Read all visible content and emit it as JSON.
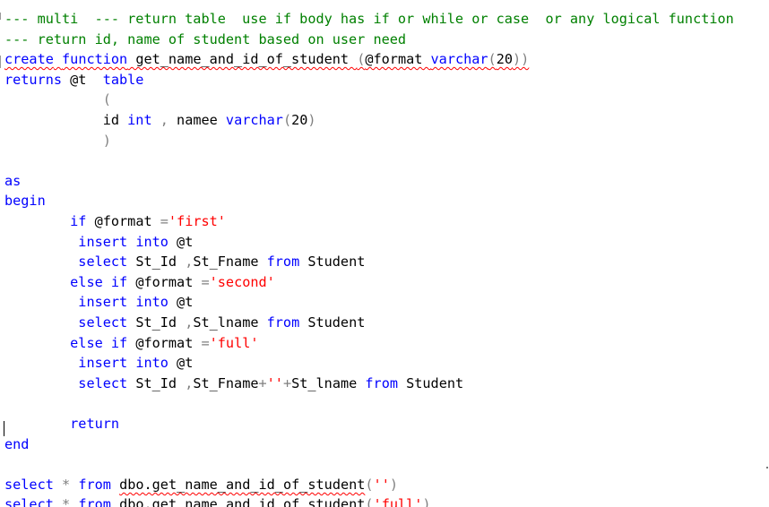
{
  "editor": {
    "lines": [
      {
        "tokens": [
          {
            "t": "--- multi  --- return table  use if body has if or while or case  or any logical function",
            "c": "cm"
          }
        ]
      },
      {
        "tokens": [
          {
            "t": "--- return id, name of student based on user need",
            "c": "cm"
          }
        ]
      },
      {
        "tokens": [
          {
            "t": "create",
            "c": "kw",
            "w": 1
          },
          {
            "t": " ",
            "c": "tx",
            "w": 1
          },
          {
            "t": "function",
            "c": "kw",
            "w": 1
          },
          {
            "t": " get_name_and_id_of_student ",
            "c": "tx",
            "w": 1
          },
          {
            "t": "(",
            "c": "op",
            "w": 1
          },
          {
            "t": "@format ",
            "c": "tx",
            "w": 1
          },
          {
            "t": "varchar",
            "c": "kw",
            "w": 1
          },
          {
            "t": "(",
            "c": "op",
            "w": 1
          },
          {
            "t": "20",
            "c": "tx",
            "w": 1
          },
          {
            "t": "))",
            "c": "op",
            "w": 1
          }
        ]
      },
      {
        "tokens": [
          {
            "t": "returns",
            "c": "kw"
          },
          {
            "t": " @t  ",
            "c": "tx"
          },
          {
            "t": "table",
            "c": "kw"
          }
        ]
      },
      {
        "tokens": [
          {
            "t": "            ",
            "c": "tx"
          },
          {
            "t": "(",
            "c": "op"
          }
        ]
      },
      {
        "tokens": [
          {
            "t": "            id ",
            "c": "tx"
          },
          {
            "t": "int",
            "c": "kw"
          },
          {
            "t": " ",
            "c": "tx"
          },
          {
            "t": ",",
            "c": "op"
          },
          {
            "t": " namee ",
            "c": "tx"
          },
          {
            "t": "varchar",
            "c": "kw"
          },
          {
            "t": "(",
            "c": "op"
          },
          {
            "t": "20",
            "c": "tx"
          },
          {
            "t": ")",
            "c": "op"
          }
        ]
      },
      {
        "tokens": [
          {
            "t": "            ",
            "c": "tx"
          },
          {
            "t": ")",
            "c": "op"
          }
        ]
      },
      {
        "tokens": []
      },
      {
        "tokens": [
          {
            "t": "as",
            "c": "kw"
          }
        ]
      },
      {
        "tokens": [
          {
            "t": "begin",
            "c": "kw"
          }
        ]
      },
      {
        "tokens": [
          {
            "t": "        ",
            "c": "tx"
          },
          {
            "t": "if",
            "c": "kw"
          },
          {
            "t": " @format ",
            "c": "tx"
          },
          {
            "t": "=",
            "c": "op"
          },
          {
            "t": "'first'",
            "c": "st"
          }
        ]
      },
      {
        "tokens": [
          {
            "t": "         ",
            "c": "tx"
          },
          {
            "t": "insert",
            "c": "kw"
          },
          {
            "t": " ",
            "c": "tx"
          },
          {
            "t": "into",
            "c": "kw"
          },
          {
            "t": " @t",
            "c": "tx"
          }
        ]
      },
      {
        "tokens": [
          {
            "t": "         ",
            "c": "tx"
          },
          {
            "t": "select",
            "c": "kw"
          },
          {
            "t": " St_Id ",
            "c": "tx"
          },
          {
            "t": ",",
            "c": "op"
          },
          {
            "t": "St_Fname ",
            "c": "tx"
          },
          {
            "t": "from",
            "c": "kw"
          },
          {
            "t": " Student",
            "c": "tx"
          }
        ]
      },
      {
        "tokens": [
          {
            "t": "        ",
            "c": "tx"
          },
          {
            "t": "else",
            "c": "kw"
          },
          {
            "t": " ",
            "c": "tx"
          },
          {
            "t": "if",
            "c": "kw"
          },
          {
            "t": " @format ",
            "c": "tx"
          },
          {
            "t": "=",
            "c": "op"
          },
          {
            "t": "'second'",
            "c": "st"
          }
        ]
      },
      {
        "tokens": [
          {
            "t": "         ",
            "c": "tx"
          },
          {
            "t": "insert",
            "c": "kw"
          },
          {
            "t": " ",
            "c": "tx"
          },
          {
            "t": "into",
            "c": "kw"
          },
          {
            "t": " @t",
            "c": "tx"
          }
        ]
      },
      {
        "tokens": [
          {
            "t": "         ",
            "c": "tx"
          },
          {
            "t": "select",
            "c": "kw"
          },
          {
            "t": " St_Id ",
            "c": "tx"
          },
          {
            "t": ",",
            "c": "op"
          },
          {
            "t": "St_lname ",
            "c": "tx"
          },
          {
            "t": "from",
            "c": "kw"
          },
          {
            "t": " Student",
            "c": "tx"
          }
        ]
      },
      {
        "tokens": [
          {
            "t": "        ",
            "c": "tx"
          },
          {
            "t": "else",
            "c": "kw"
          },
          {
            "t": " ",
            "c": "tx"
          },
          {
            "t": "if",
            "c": "kw"
          },
          {
            "t": " @format ",
            "c": "tx"
          },
          {
            "t": "=",
            "c": "op"
          },
          {
            "t": "'full'",
            "c": "st"
          }
        ]
      },
      {
        "tokens": [
          {
            "t": "         ",
            "c": "tx"
          },
          {
            "t": "insert",
            "c": "kw"
          },
          {
            "t": " ",
            "c": "tx"
          },
          {
            "t": "into",
            "c": "kw"
          },
          {
            "t": " @t",
            "c": "tx"
          }
        ]
      },
      {
        "tokens": [
          {
            "t": "         ",
            "c": "tx"
          },
          {
            "t": "select",
            "c": "kw"
          },
          {
            "t": " St_Id ",
            "c": "tx"
          },
          {
            "t": ",",
            "c": "op"
          },
          {
            "t": "St_Fname",
            "c": "tx"
          },
          {
            "t": "+",
            "c": "op"
          },
          {
            "t": "''",
            "c": "st"
          },
          {
            "t": "+",
            "c": "op"
          },
          {
            "t": "St_lname ",
            "c": "tx"
          },
          {
            "t": "from",
            "c": "kw"
          },
          {
            "t": " Student",
            "c": "tx"
          }
        ]
      },
      {
        "tokens": []
      },
      {
        "tokens": [
          {
            "t": "        ",
            "c": "tx"
          },
          {
            "t": "return",
            "c": "kw"
          }
        ]
      },
      {
        "tokens": [
          {
            "t": "end",
            "c": "kw"
          }
        ]
      },
      {
        "tokens": []
      },
      {
        "tokens": [
          {
            "t": "select",
            "c": "kw"
          },
          {
            "t": " ",
            "c": "tx"
          },
          {
            "t": "*",
            "c": "op"
          },
          {
            "t": " ",
            "c": "tx"
          },
          {
            "t": "from",
            "c": "kw"
          },
          {
            "t": " ",
            "c": "tx"
          },
          {
            "t": "dbo.get_name_and_id_of_student",
            "c": "tx",
            "w": 1
          },
          {
            "t": "(",
            "c": "op"
          },
          {
            "t": "''",
            "c": "st"
          },
          {
            "t": ")",
            "c": "op"
          }
        ]
      },
      {
        "tokens": [
          {
            "t": "select",
            "c": "kw"
          },
          {
            "t": " ",
            "c": "tx"
          },
          {
            "t": "*",
            "c": "op"
          },
          {
            "t": " ",
            "c": "tx"
          },
          {
            "t": "from",
            "c": "kw"
          },
          {
            "t": " ",
            "c": "tx"
          },
          {
            "t": "dbo.get_name_and_id_of_student",
            "c": "tx",
            "w": 1
          },
          {
            "t": "(",
            "c": "op"
          },
          {
            "t": "'full'",
            "c": "st"
          },
          {
            "t": ")",
            "c": "op"
          }
        ]
      }
    ]
  }
}
